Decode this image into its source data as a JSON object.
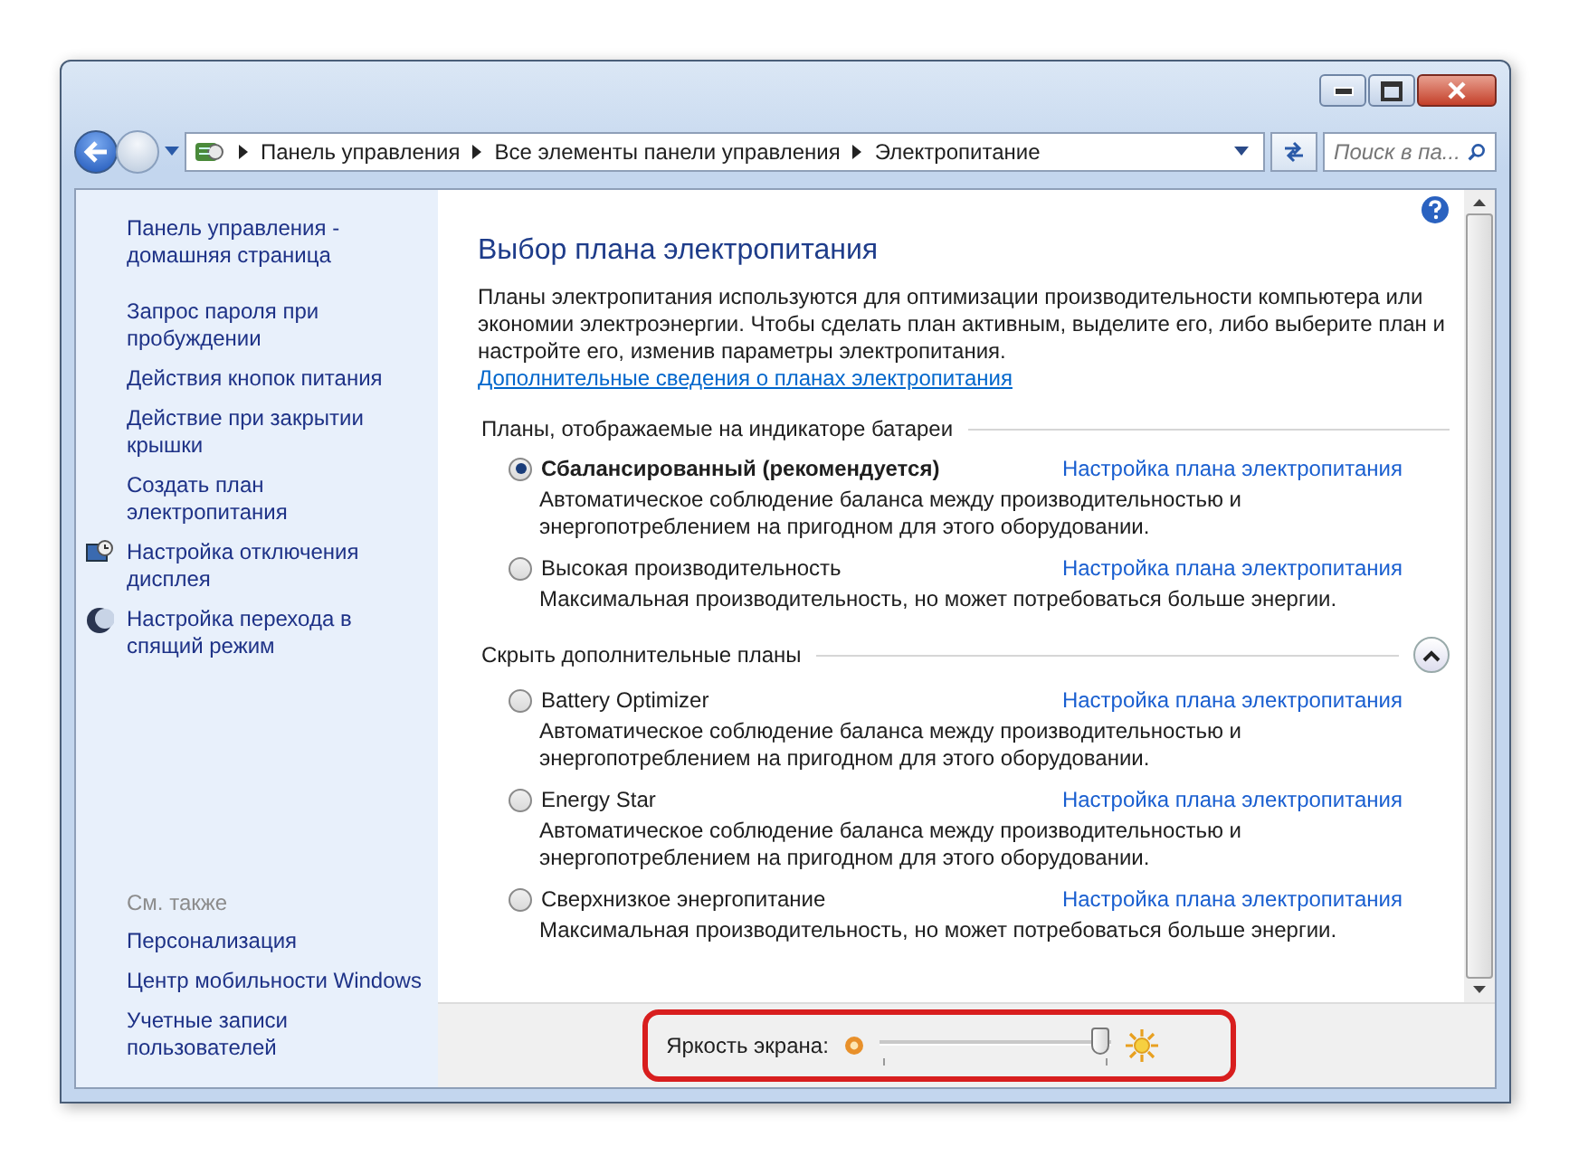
{
  "address_bar": {
    "path": [
      "Панель управления",
      "Все элементы панели управления",
      "Электропитание"
    ]
  },
  "search": {
    "placeholder": "Поиск в па..."
  },
  "sidebar": {
    "links": [
      {
        "label": "Панель управления - домашняя страница",
        "kind": "home"
      },
      {
        "label": "Запрос пароля при пробуждении",
        "kind": "plain"
      },
      {
        "label": "Действия кнопок питания",
        "kind": "plain"
      },
      {
        "label": "Действие при закрытии крышки",
        "kind": "plain"
      },
      {
        "label": "Создать план электропитания",
        "kind": "plain"
      },
      {
        "label": "Настройка отключения дисплея",
        "kind": "display"
      },
      {
        "label": "Настройка перехода в спящий режим",
        "kind": "sleep"
      }
    ],
    "see_also_title": "См. также",
    "see_also": [
      "Персонализация",
      "Центр мобильности Windows",
      "Учетные записи пользователей"
    ]
  },
  "main": {
    "title": "Выбор плана электропитания",
    "intro": "Планы электропитания используются для оптимизации производительности компьютера или экономии электроэнергии. Чтобы сделать план активным, выделите его, либо выберите план и настройте его, изменив параметры электропитания.",
    "intro_link": "Дополнительные сведения о планах электропитания",
    "groups": [
      {
        "title": "Планы, отображаемые на индикаторе батареи",
        "collapsible": false,
        "plans": [
          {
            "name": "Сбалансированный (рекомендуется)",
            "selected": true,
            "description": "Автоматическое соблюдение баланса между производительностью и энергопотреблением на пригодном для этого оборудовании.",
            "link": "Настройка плана электропитания"
          },
          {
            "name": "Высокая производительность",
            "selected": false,
            "description": "Максимальная производительность, но может потребоваться больше энергии.",
            "link": "Настройка плана электропитания"
          }
        ]
      },
      {
        "title": "Скрыть дополнительные планы",
        "collapsible": true,
        "plans": [
          {
            "name": "Battery Optimizer",
            "selected": false,
            "description": "Автоматическое соблюдение баланса между производительностью и энергопотреблением на пригодном для этого оборудовании.",
            "link": "Настройка плана электропитания"
          },
          {
            "name": "Energy Star",
            "selected": false,
            "description": "Автоматическое соблюдение баланса между производительностью и энергопотреблением на пригодном для этого оборудовании.",
            "link": "Настройка плана электропитания"
          },
          {
            "name": "Сверхнизкое энергопитание",
            "selected": false,
            "description": "Максимальная производительность, но может потребоваться больше энергии.",
            "link": "Настройка плана электропитания"
          }
        ]
      }
    ]
  },
  "brightness": {
    "label": "Яркость экрана:",
    "level": 0.95
  }
}
